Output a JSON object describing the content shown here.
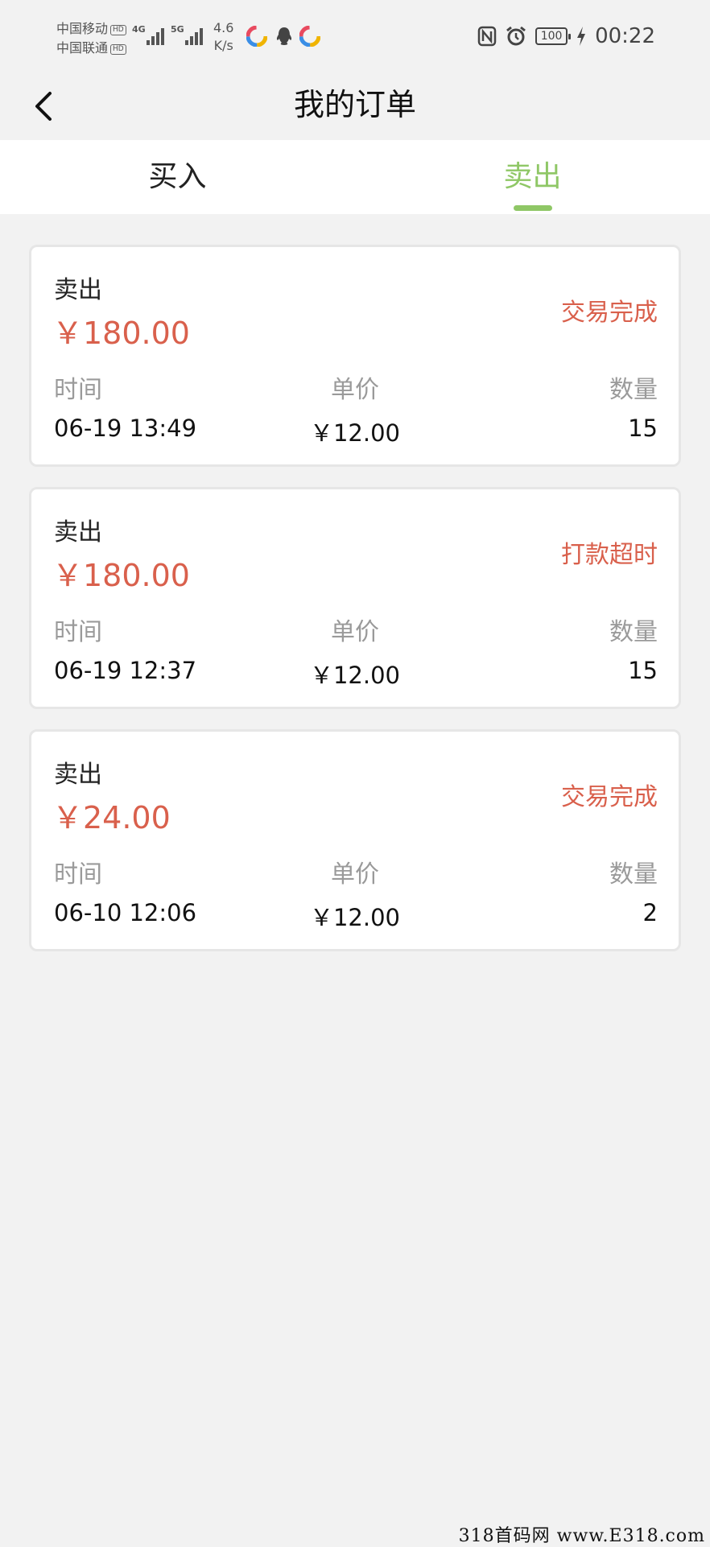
{
  "status_bar": {
    "carrier_1": "中国移动",
    "carrier_2": "中国联通",
    "hd_badge": "HD",
    "signal_1_label": "4G",
    "signal_2_label": "5G",
    "speed_value": "4.6",
    "speed_unit": "K/s",
    "battery": "100",
    "time": "00:22"
  },
  "header": {
    "title": "我的订单"
  },
  "tabs": [
    {
      "label": "买入",
      "active": false
    },
    {
      "label": "卖出",
      "active": true
    }
  ],
  "orders": [
    {
      "type": "卖出",
      "amount": "￥180.00",
      "status": "交易完成",
      "time_label": "时间",
      "price_label": "单价",
      "qty_label": "数量",
      "time": "06-19 13:49",
      "price": "￥12.00",
      "qty": "15"
    },
    {
      "type": "卖出",
      "amount": "￥180.00",
      "status": "打款超时",
      "time_label": "时间",
      "price_label": "单价",
      "qty_label": "数量",
      "time": "06-19 12:37",
      "price": "￥12.00",
      "qty": "15"
    },
    {
      "type": "卖出",
      "amount": "￥24.00",
      "status": "交易完成",
      "time_label": "时间",
      "price_label": "单价",
      "qty_label": "数量",
      "time": "06-10 12:06",
      "price": "￥12.00",
      "qty": "2"
    }
  ],
  "watermark": "318首码网 www.E318.com",
  "colors": {
    "accent_green": "#8fc766",
    "status_red": "#d9604c",
    "background": "#f2f2f2"
  }
}
